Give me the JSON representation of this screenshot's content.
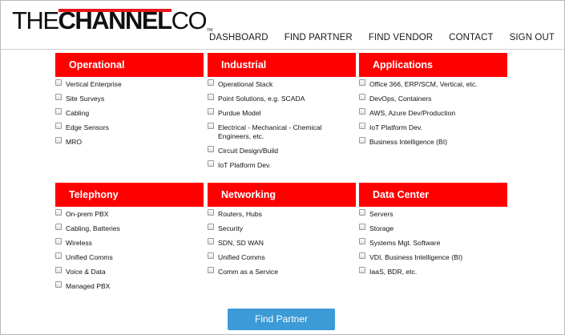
{
  "logo": {
    "the": "THE",
    "channel": "CHANNEL",
    "co": "CO",
    "tm": "TM"
  },
  "nav": [
    "DASHBOARD",
    "FIND PARTNER",
    "FIND VENDOR",
    "CONTACT",
    "SIGN OUT"
  ],
  "categories": [
    {
      "title": "Operational",
      "options": [
        "Vertical Enterprise",
        "Site Surveys",
        "Cabling",
        "Edge Sensors",
        "MRO"
      ]
    },
    {
      "title": "Industrial",
      "options": [
        "Operational Stack",
        "Point Solutions, e.g. SCADA",
        "Purdue Model",
        "Electrical - Mechanical - Chemical Engineers, etc.",
        "Circuit Design/Build",
        "IoT Platform Dev."
      ]
    },
    {
      "title": "Applications",
      "options": [
        "Office 366, ERP/SCM, Vertical, etc.",
        "DevOps, Containers",
        "AWS, Azure Dev/Production",
        "IoT Platform Dev.",
        "Business Intelligence (BI)"
      ]
    },
    {
      "title": "Telephony",
      "options": [
        "On-prem PBX",
        "Cabling, Batteries",
        "Wireless",
        "Unified Comms",
        "Voice & Data",
        "Managed PBX"
      ]
    },
    {
      "title": "Networking",
      "options": [
        "Routers, Hubs",
        "Security",
        "SDN, SD WAN",
        "Unified Comms",
        "Comm as a Service"
      ]
    },
    {
      "title": "Data Center",
      "options": [
        "Servers",
        "Storage",
        "Systems Mgt. Software",
        "VDI, Business Intelligence (BI)",
        "IaaS, BDR, etc."
      ]
    }
  ],
  "find_button": "Find Partner",
  "colors": {
    "header_red": "#fe0000",
    "button_blue": "#3c9ad7",
    "logo_red": "#e8171d"
  }
}
